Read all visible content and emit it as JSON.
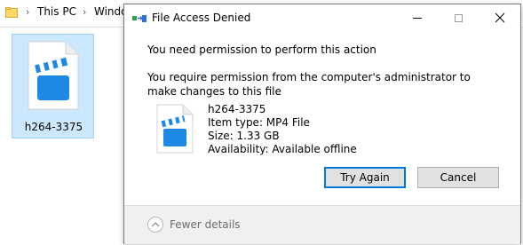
{
  "explorer": {
    "breadcrumb": [
      "This PC",
      "Windo"
    ],
    "file_name": "h264-3375"
  },
  "dialog": {
    "title": "File Access Denied",
    "heading": "You need permission to perform this action",
    "message": "You require permission from the computer's administrator to make changes to this file",
    "file_info": {
      "name": "h264-3375",
      "type": "Item type: MP4 File",
      "size": "Size: 1.33 GB",
      "availability": "Availability: Available offline"
    },
    "buttons": {
      "try_again": "Try Again",
      "cancel": "Cancel"
    },
    "footer": {
      "fewer_details": "Fewer details"
    }
  },
  "colors": {
    "video_icon_blue": "#1e88e5",
    "selection_bg": "#cce8ff",
    "default_button_border": "#0078d7"
  }
}
